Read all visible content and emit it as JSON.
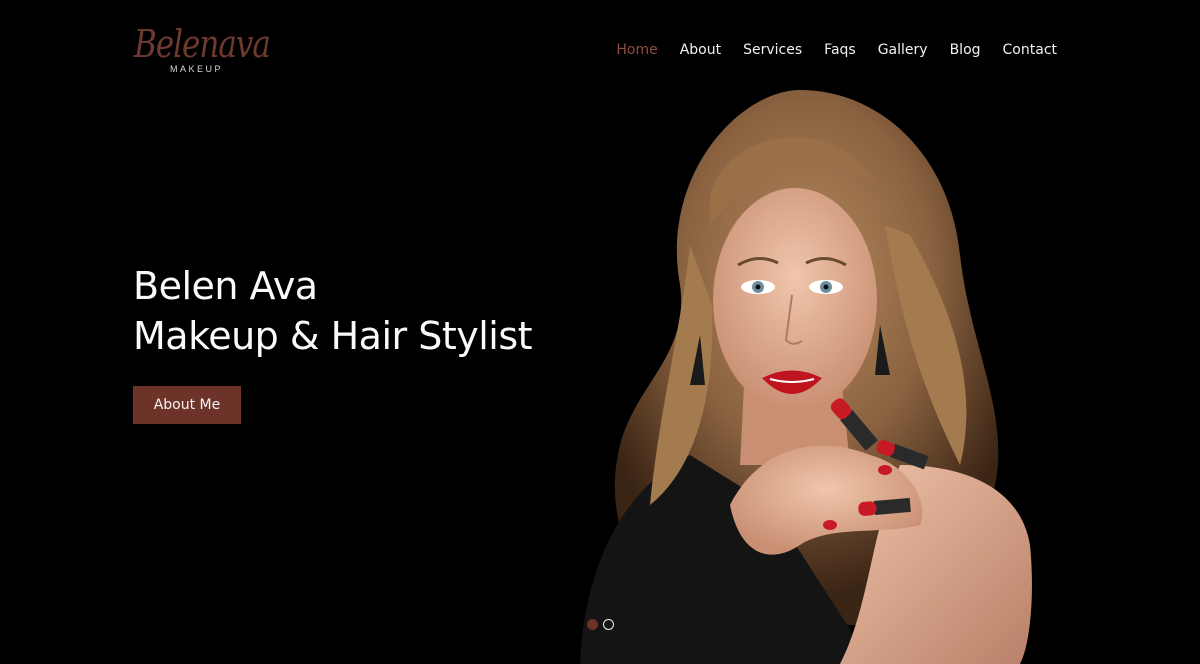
{
  "brand": {
    "script": "Belenava",
    "subtitle": "MAKEUP",
    "color": "#6e3a30"
  },
  "nav": {
    "items": [
      {
        "label": "Home",
        "active": true
      },
      {
        "label": "About"
      },
      {
        "label": "Services"
      },
      {
        "label": "Faqs"
      },
      {
        "label": "Gallery"
      },
      {
        "label": "Blog"
      },
      {
        "label": "Contact"
      }
    ],
    "active_color": "#8d4d40"
  },
  "hero": {
    "line1": "Belen Ava",
    "line2": "Makeup & Hair Stylist",
    "cta_label": "About Me",
    "cta_color": "#6d3329",
    "image_icon": "woman-with-lipstick-portrait"
  },
  "slider": {
    "count": 2,
    "active_index": 0
  }
}
